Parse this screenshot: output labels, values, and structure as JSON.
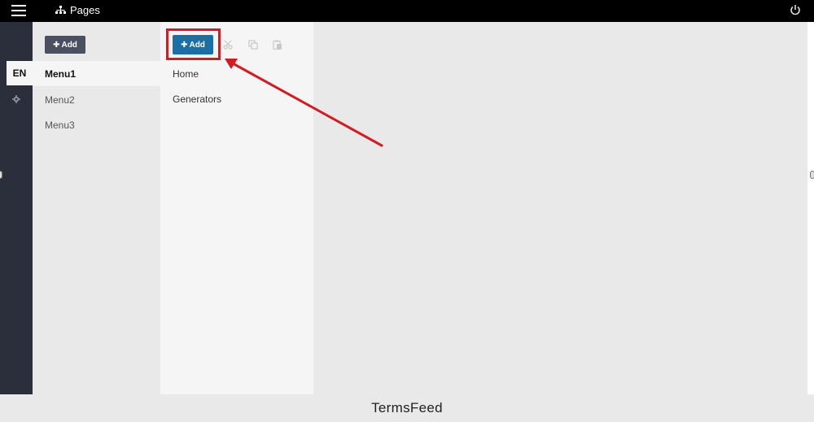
{
  "header": {
    "title": "Pages",
    "menu_icon": "hamburger-icon",
    "title_icon": "sitemap-icon",
    "power_icon": "power-icon"
  },
  "rail": {
    "language": "EN",
    "settings_icon": "gear-icon"
  },
  "menus": {
    "add_label": "Add",
    "items": [
      {
        "label": "Menu1",
        "active": true
      },
      {
        "label": "Menu2",
        "active": false
      },
      {
        "label": "Menu3",
        "active": false
      }
    ]
  },
  "pages": {
    "add_label": "Add",
    "tool_icons": [
      "scissors-icon",
      "copy-icon",
      "paste-icon"
    ],
    "items": [
      {
        "label": "Home"
      },
      {
        "label": "Generators"
      }
    ]
  },
  "colors": {
    "topbar": "#000000",
    "rail": "#2b2f3c",
    "add_page_button": "#1a6fa4",
    "add_menu_button": "#4a5060",
    "annotation": "#d21c24"
  },
  "footer": {
    "brand": "TermsFeed"
  }
}
